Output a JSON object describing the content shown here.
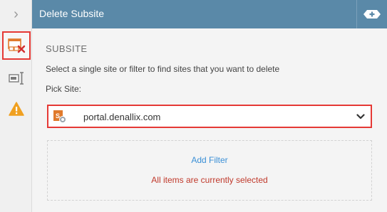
{
  "rail": {
    "toggle_glyph": "›",
    "buttons": [
      {
        "icon": "delete-site-icon",
        "active": true
      },
      {
        "icon": "text-cursor-icon",
        "active": false
      },
      {
        "icon": "warning-icon",
        "active": false
      }
    ]
  },
  "header": {
    "title": "Delete Subsite",
    "tool_icon": "add-toolbar-icon"
  },
  "form": {
    "section_title": "SUBSITE",
    "description": "Select a single site or filter to find sites that you want to delete",
    "pick_label": "Pick Site:",
    "selected_site": "portal.denallix.com",
    "add_filter_label": "Add Filter",
    "status_text": "All items are currently selected"
  },
  "colors": {
    "header_bg": "#5a89a8",
    "highlight": "#e53935",
    "link": "#3a8fd6",
    "status": "#c0392b",
    "warning": "#f0a020"
  }
}
